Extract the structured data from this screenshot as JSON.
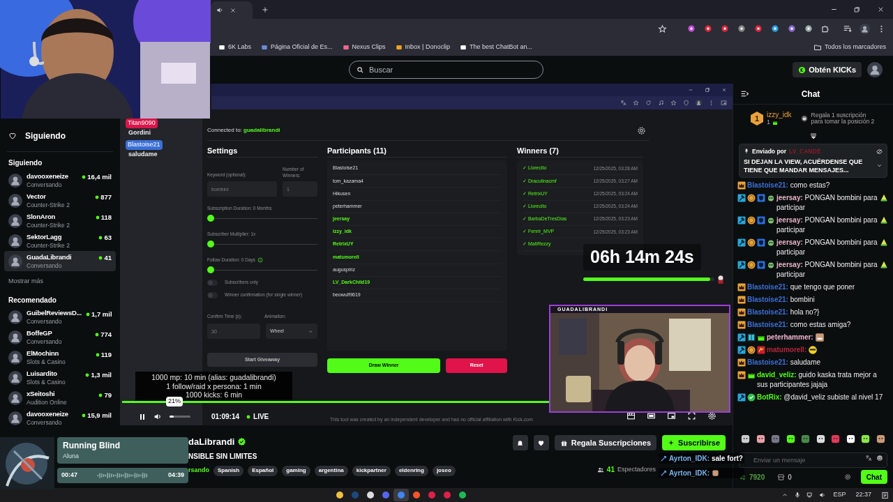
{
  "browser": {
    "bookmarks": [
      "6K Labs",
      "Página Oficial de Es...",
      "Nexus Clips",
      "Inbox | Donoclip",
      "The best ChatBot an..."
    ],
    "all_bookmarks": "Todos los marcadores"
  },
  "header": {
    "search_placeholder": "Buscar",
    "kicks_button": "Obtén KICKs"
  },
  "sidebar": {
    "nav": [
      {
        "label": "Siguiendo"
      }
    ],
    "following_title": "Siguiendo",
    "following": [
      {
        "name": "davooxeneize",
        "category": "Conversando",
        "viewers": "16,4 mil",
        "selected": false
      },
      {
        "name": "Vector",
        "category": "Counter-Strike 2",
        "viewers": "877",
        "selected": false
      },
      {
        "name": "SlonAron",
        "category": "Counter-Strike 2",
        "viewers": "118",
        "selected": false
      },
      {
        "name": "SektorLagg",
        "category": "Counter-Strike 2",
        "viewers": "63",
        "selected": false
      },
      {
        "name": "GuadaLibrandi",
        "category": "Conversando",
        "viewers": "41",
        "selected": true
      }
    ],
    "show_more": "Mostrar más",
    "recommended_title": "Recomendado",
    "recommended": [
      {
        "name": "GuibelReviewsD...",
        "category": "Conversando",
        "viewers": "1,7 mil",
        "selected": false
      },
      {
        "name": "BoffeGP",
        "category": "Conversando",
        "viewers": "774",
        "selected": false
      },
      {
        "name": "ElMochinn",
        "category": "Slots & Casino",
        "viewers": "119",
        "selected": false
      },
      {
        "name": "Luisardito",
        "category": "Slots & Casino",
        "viewers": "1,3 mil",
        "selected": false
      },
      {
        "name": "xSeitoshi",
        "category": "Audition Online",
        "viewers": "79",
        "selected": false
      },
      {
        "name": "davooxeneize",
        "category": "Conversando",
        "viewers": "15,9 mil",
        "selected": false
      }
    ]
  },
  "stream_chat_overlay": [
    {
      "user": "Titan9090",
      "text": "Gordini",
      "color": "#d9164a"
    },
    {
      "user": "Blastoise21",
      "text": "saludame",
      "color": "#3b6fd6"
    }
  ],
  "giveaway": {
    "connected_label": "Connected to:",
    "channel": "guadalibrandi",
    "settings": {
      "title": "Settings",
      "keyword_label": "Keyword (optional):",
      "keyword_placeholder": "bombini",
      "winners_label": "Number of Winners:",
      "winners_placeholder": "1",
      "sliders": [
        {
          "label": "Subscription Duration: 0 Months",
          "level": 0,
          "info": false
        },
        {
          "label": "Subscriber Multiplier: 1x",
          "level": 0,
          "info": false
        },
        {
          "label": "Follow Duration: 0 Days",
          "level": 0,
          "info": true
        }
      ],
      "toggles": [
        {
          "label": "Subscribers only",
          "on": false
        },
        {
          "label": "Winner confirmation (for single winner)",
          "on": false
        }
      ],
      "confirm_label": "Confirm Time (s):",
      "confirm_placeholder": "30",
      "animation_label": "Animation:",
      "animation_value": "Wheel",
      "start_button": "Start Giveaway"
    },
    "participants_title": "Participants (11)",
    "participants": [
      {
        "name": "Blastoise21",
        "highlighted": false
      },
      {
        "name": "tom_kazama4",
        "highlighted": false
      },
      {
        "name": "Hikusen",
        "highlighted": false
      },
      {
        "name": "peterhammer",
        "highlighted": false
      },
      {
        "name": "jeersay",
        "highlighted": true
      },
      {
        "name": "izzy_idk",
        "highlighted": true
      },
      {
        "name": "RetrixUY",
        "highlighted": true
      },
      {
        "name": "matumorell",
        "highlighted": true
      },
      {
        "name": "auguspiriz",
        "highlighted": false
      },
      {
        "name": "LV_DarkChild19",
        "highlighted": true
      },
      {
        "name": "beowulf9619",
        "highlighted": false
      }
    ],
    "draw_button": "Draw Winner",
    "reset_button": "Reset",
    "winners_title": "Winners (7)",
    "winners": [
      {
        "name": "✓ Llorecito",
        "time": "12/25/2025, 03:28 AM"
      },
      {
        "name": "✓ Draculinacmf",
        "time": "12/25/2025, 03:27 AM"
      },
      {
        "name": "✓ RetrixUY",
        "time": "12/25/2025, 03:24 AM"
      },
      {
        "name": "✓ Llorecito",
        "time": "12/25/2025, 03:24 AM"
      },
      {
        "name": "✓ BarbaDeTresDias",
        "time": "12/25/2025, 03:23 AM"
      },
      {
        "name": "✓ Fenrir_MVP",
        "time": "12/25/2025, 03:23 AM"
      },
      {
        "name": "✓ MatiRezzy"
      }
    ],
    "footer": "This tool was created by an independent developer and has no official affiliation with Kick.com"
  },
  "stream_overlay_text": [
    "1000 mp: 10 min (alias: guadalibrandi)",
    "1 follow/raid x persona: 1 min",
    "1000 kicks: 6 min"
  ],
  "player": {
    "volume": {
      "level": 0.21,
      "tooltip": "21%"
    },
    "time": "01:09:14",
    "live": "LIVE"
  },
  "timer": {
    "text": "06h 14m 24s",
    "level": 0.97
  },
  "webcam_label": "GUADALIBRANDI",
  "channel": {
    "name": "daLibrandi",
    "verified": true,
    "title": "NSIBLE SIN LIMITES",
    "category": "rsando",
    "tags": [
      "Spanish",
      "Español",
      "gaming",
      "argentina",
      "kickpartner",
      "eldenring",
      "joseo"
    ],
    "gift_button": "Regala Suscripciones",
    "subscribe_button": "Suscribirse",
    "viewers": "41",
    "viewers_label": "Espectadores"
  },
  "floating_chat": [
    {
      "user": "Ayrton_IDK:",
      "text": "sale fort?"
    },
    {
      "user": "Ayrton_IDK:"
    }
  ],
  "chat": {
    "title": "Chat",
    "leader": {
      "rank": "1",
      "name": "izzy_idk",
      "count": "1",
      "prompt": "Regala 1 suscripción para tomar la posición 2"
    },
    "pinned": {
      "label": "Enviado por",
      "sender": "LV_CANDE",
      "text": "SI DEJAN LA VIEW, ACUÉRDENSE QUE TIENE QUE MANDAR MENSAJES..."
    },
    "messages": [
      {
        "kind": "crown",
        "user": "Blastoise21:",
        "text": "como estas?",
        "color": "#3b6fd6"
      },
      {
        "kind": "mod_sub",
        "user": "jeersay:",
        "text": "PONGAN bombini para participar",
        "color": "#e8b4c8"
      },
      {
        "kind": "mod_sub",
        "user": "jeersay:",
        "text": "PONGAN bombini para participar",
        "color": "#e8b4c8"
      },
      {
        "kind": "mod_sub",
        "user": "jeersay:",
        "text": "PONGAN bombini para participar",
        "color": "#e8b4c8"
      },
      {
        "kind": "mod_sub",
        "user": "jeersay:",
        "text": "PONGAN bombini para participar",
        "color": "#e8b4c8"
      },
      {
        "kind": "crown",
        "user": "Blastoise21:",
        "text": "que tengo que poner",
        "color": "#3b6fd6"
      },
      {
        "kind": "crown",
        "user": "Blastoise21:",
        "text": "bombini",
        "color": "#3b6fd6"
      },
      {
        "kind": "crown",
        "user": "Blastoise21:",
        "text": "hola no?}",
        "color": "#3b6fd6"
      },
      {
        "kind": "crown",
        "user": "Blastoise21:",
        "text": "como estas amiga?",
        "color": "#3b6fd6"
      },
      {
        "kind": "mod_vip",
        "user": "peterhammer:",
        "color": "#f2b6d0"
      },
      {
        "kind": "mod_coin",
        "user": "matumorell:",
        "color": "#b3263a"
      },
      {
        "kind": "crown",
        "user": "Blastoise21:",
        "text": "saludame",
        "color": "#3b6fd6"
      },
      {
        "kind": "crown_gift",
        "user": "david_veliz:",
        "text": "guido kaska trata mejor a sus participantes jajaja",
        "color": "#53fc18"
      },
      {
        "kind": "mod_bot",
        "user": "BotRix:",
        "text": "@david_veliz subiste al nivel 17",
        "color": "#53fc18"
      }
    ],
    "input_placeholder": "Enviar un mensaje",
    "points": "7920",
    "count": "0",
    "chat_button": "Chat"
  },
  "music": {
    "title": "Running Blind",
    "artist": "Aluna",
    "elapsed": "00:47",
    "duration": "04:39"
  },
  "taskbar": {
    "language": "ESP",
    "time": "22:37"
  }
}
